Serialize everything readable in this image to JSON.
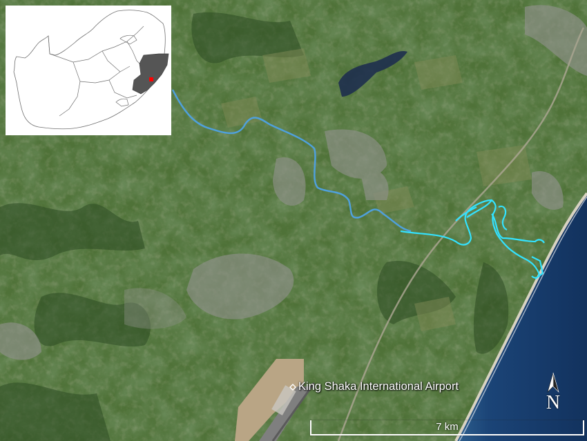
{
  "map": {
    "type": "satellite-imagery",
    "features": [
      "river",
      "estuary",
      "coastline",
      "ocean",
      "airport",
      "highway",
      "towns",
      "farmland",
      "dam"
    ],
    "colors": {
      "land": "#4a6b35",
      "ocean": "#173c6e",
      "river": "#4fa3e0",
      "estuary_highlight": "#2de4ff",
      "urban": "#8d8f86",
      "province_highlight": "#555555",
      "site_marker": "#ff0000"
    }
  },
  "inset": {
    "type": "locator-map",
    "highlighted_region_color": "#555555",
    "marker_color": "#ff0000"
  },
  "labels": {
    "airport": "King Shaka International Airport"
  },
  "scale_bar": {
    "label": "7 km"
  },
  "north_arrow": {
    "label": "N",
    "icon": "north-arrow-icon"
  }
}
